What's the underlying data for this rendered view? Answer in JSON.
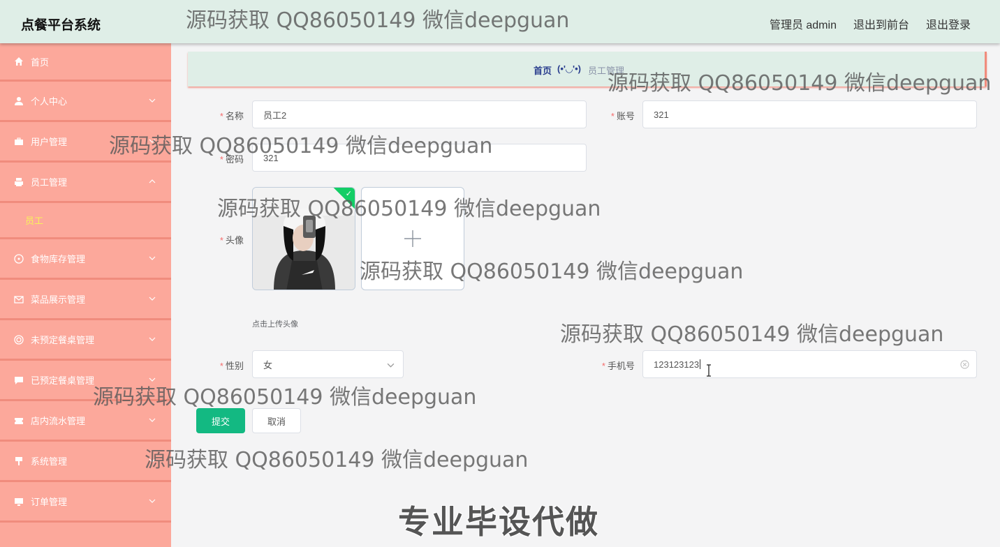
{
  "header": {
    "title": "点餐平台系统",
    "admin_label": "管理员 admin",
    "to_front": "退出到前台",
    "logout": "退出登录"
  },
  "sidebar": {
    "items": [
      {
        "label": "首页",
        "icon": "home-icon"
      },
      {
        "label": "个人中心",
        "icon": "user-icon"
      },
      {
        "label": "用户管理",
        "icon": "briefcase-icon"
      },
      {
        "label": "员工管理",
        "icon": "printer-icon"
      },
      {
        "label": "食物库存管理",
        "icon": "compass-icon"
      },
      {
        "label": "菜品展示管理",
        "icon": "mail-icon"
      },
      {
        "label": "未预定餐桌管理",
        "icon": "lifebuoy-icon"
      },
      {
        "label": "已预定餐桌管理",
        "icon": "chat-icon"
      },
      {
        "label": "店内流水管理",
        "icon": "ticket-icon"
      },
      {
        "label": "系统管理",
        "icon": "sign-icon"
      },
      {
        "label": "订单管理",
        "icon": "monitor-icon"
      }
    ],
    "sub_item": "员工"
  },
  "breadcrumb": {
    "home": "首页",
    "separator": "(•'◡'•)",
    "current": "员工管理"
  },
  "form": {
    "name_label": "名称",
    "name_value": "员工2",
    "account_label": "账号",
    "account_value": "321",
    "password_label": "密码",
    "password_value": "321",
    "avatar_label": "头像",
    "upload_tip": "点击上传头像",
    "gender_label": "性别",
    "gender_value": "女",
    "phone_label": "手机号",
    "phone_value": "123123123",
    "submit": "提交",
    "cancel": "取消"
  },
  "watermarks": {
    "text": "源码获取 QQ86050149 微信deepguan",
    "footer": "专业毕设代做"
  },
  "colors": {
    "sidebar_bg": "#fca89b",
    "header_bg": "#dfeee7",
    "primary": "#13b982",
    "active_sub": "#f7f25a"
  }
}
